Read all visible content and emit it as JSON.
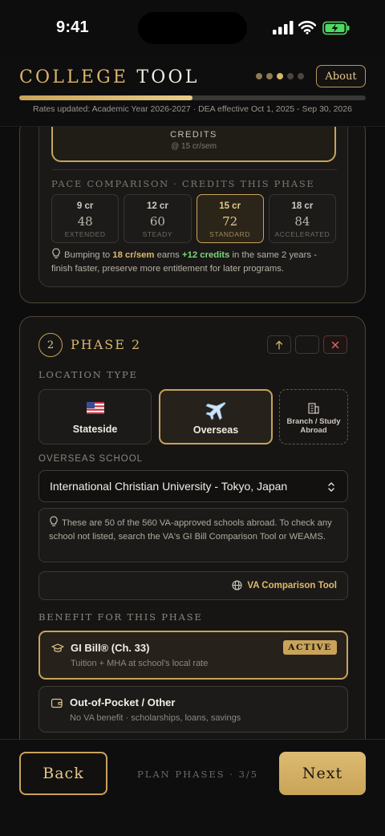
{
  "status_bar": {
    "time": "9:41"
  },
  "header": {
    "brand_first": "COLLEGE",
    "brand_second": "TOOL",
    "about_label": "About",
    "step_dots": 5,
    "current_step": 3,
    "progress_fraction": 0.5,
    "rates_note": "Rates updated: Academic Year 2026-2027 · DEA effective Oct 1, 2025 - Sep 30, 2026"
  },
  "phase1": {
    "credits_label": "CREDITS",
    "credits_sub": "@ 15 cr/sem",
    "pace_title": "PACE COMPARISON · CREDITS THIS PHASE",
    "pace_options": [
      {
        "credits": "9 cr",
        "total": "48",
        "label": "EXTENDED"
      },
      {
        "credits": "12 cr",
        "total": "60",
        "label": "STEADY"
      },
      {
        "credits": "15 cr",
        "total": "72",
        "label": "STANDARD",
        "selected": true
      },
      {
        "credits": "18 cr",
        "total": "84",
        "label": "ACCELERATED"
      }
    ],
    "tip": {
      "prefix": "Bumping to ",
      "highlight": "18 cr/sem",
      "mid": " earns ",
      "gain": "+12 credits",
      "suffix": " in the same 2 years - finish faster, preserve more entitlement for later programs."
    }
  },
  "phase2": {
    "number": "2",
    "title": "PHASE 2",
    "location_label": "LOCATION TYPE",
    "locations": [
      {
        "label": "Stateside",
        "icon": "us-flag-icon"
      },
      {
        "label": "Overseas",
        "icon": "airplane-icon",
        "selected": true
      },
      {
        "label": "Branch / Study Abroad",
        "icon": "building-icon"
      }
    ],
    "school_label": "OVERSEAS SCHOOL",
    "school_value": "International Christian University - Tokyo, Japan",
    "note": "These are 50 of the 560 VA-approved schools abroad. To check any school not listed, search the VA's GI Bill Comparison Tool or WEAMS.",
    "va_tool_label": "VA Comparison Tool",
    "benefit_label": "BENEFIT FOR THIS PHASE",
    "benefits": [
      {
        "title": "GI Bill® (Ch. 33)",
        "subtitle": "Tuition + MHA at school's local rate",
        "badge": "ACTIVE",
        "icon": "graduation-cap-icon"
      },
      {
        "title": "Out-of-Pocket / Other",
        "subtitle": "No VA benefit · scholarships, loans, savings",
        "icon": "wallet-icon"
      }
    ]
  },
  "footer": {
    "back_label": "Back",
    "step_label": "PLAN PHASES · 3/5",
    "next_label": "Next"
  },
  "colors": {
    "accent": "#c9a35a",
    "background": "#0d0d0e",
    "success": "#7dd77c",
    "danger": "#e06b5e"
  }
}
